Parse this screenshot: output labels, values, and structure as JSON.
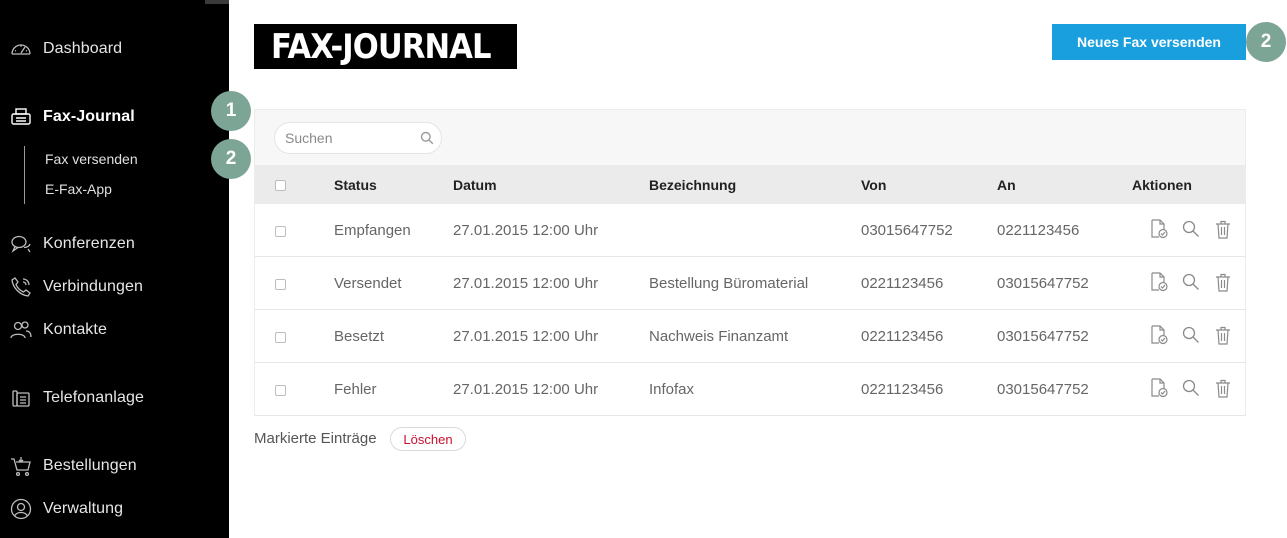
{
  "sidebar": {
    "items": [
      {
        "label": "Dashboard",
        "icon": "speedometer-icon"
      },
      {
        "label": "Fax-Journal",
        "icon": "fax-icon",
        "active": true
      },
      {
        "label": "Konferenzen",
        "icon": "chat-bubbles-icon"
      },
      {
        "label": "Verbindungen",
        "icon": "phone-icon"
      },
      {
        "label": "Kontakte",
        "icon": "contacts-icon"
      },
      {
        "label": "Telefonanlage",
        "icon": "phone-system-icon"
      },
      {
        "label": "Bestellungen",
        "icon": "cart-icon"
      },
      {
        "label": "Verwaltung",
        "icon": "user-circle-icon"
      }
    ],
    "subitems": [
      {
        "label": "Fax versenden"
      },
      {
        "label": "E-Fax-App"
      }
    ]
  },
  "steps": {
    "a": "1",
    "b": "2",
    "c": "2"
  },
  "header": {
    "title": "FAX-JOURNAL",
    "new_fax_label": "Neues Fax versenden"
  },
  "search": {
    "placeholder": "Suchen"
  },
  "table": {
    "columns": [
      "Status",
      "Datum",
      "Bezeichnung",
      "Von",
      "An",
      "Aktionen"
    ],
    "rows": [
      {
        "status": "Empfangen",
        "datum": "27.01.2015 12:00 Uhr",
        "bezeichnung": "",
        "von": "03015647752",
        "an": "0221123456"
      },
      {
        "status": "Versendet",
        "datum": "27.01.2015 12:00 Uhr",
        "bezeichnung": "Bestellung Büromaterial",
        "von": "0221123456",
        "an": "03015647752"
      },
      {
        "status": "Besetzt",
        "datum": "27.01.2015 12:00 Uhr",
        "bezeichnung": "Nachweis Finanzamt",
        "von": "0221123456",
        "an": "03015647752"
      },
      {
        "status": "Fehler",
        "datum": "27.01.2015 12:00 Uhr",
        "bezeichnung": "Infofax",
        "von": "0221123456",
        "an": "03015647752"
      }
    ]
  },
  "footer": {
    "marked_label": "Markierte Einträge",
    "delete_label": "Löschen"
  },
  "colors": {
    "accent": "#1a9fde",
    "step_badge": "#7da596",
    "delete_text": "#c8102e",
    "sidebar_bg": "#000000"
  }
}
